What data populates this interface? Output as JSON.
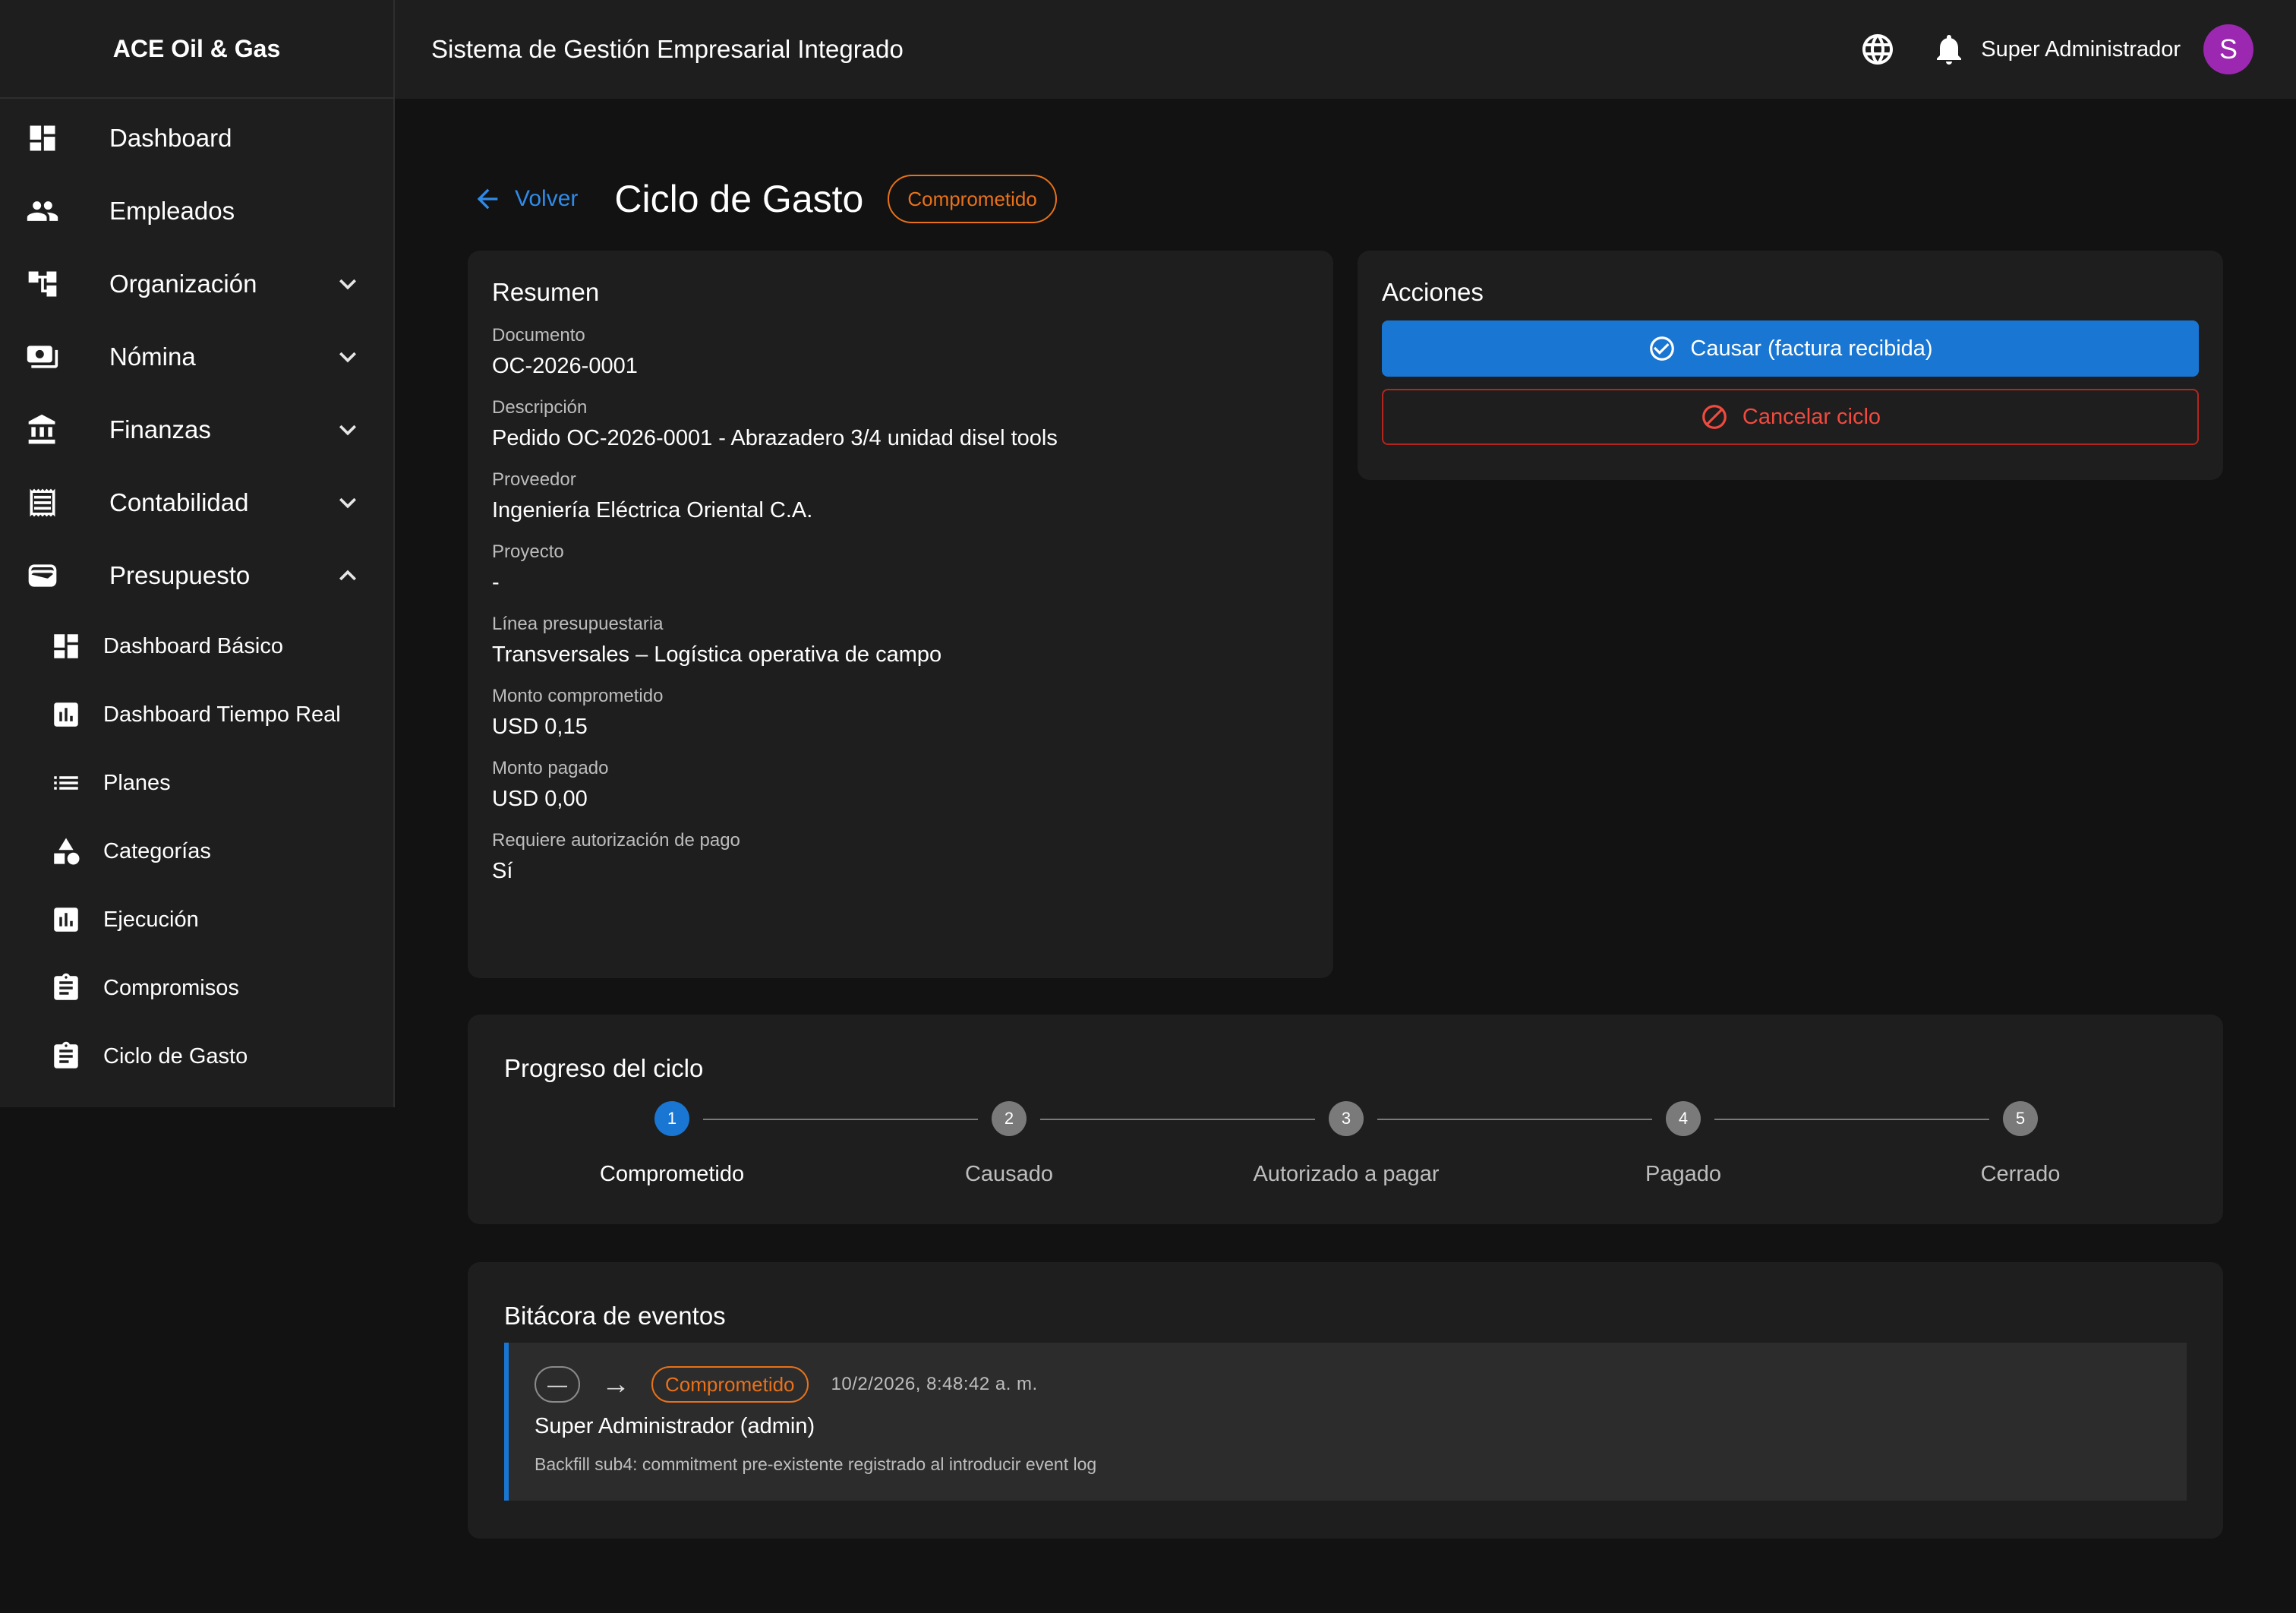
{
  "app": {
    "brand": "ACE Oil & Gas",
    "title": "Sistema de Gestión Empresarial Integrado"
  },
  "topbar": {
    "user_name": "Super Administrador",
    "avatar_initial": "S"
  },
  "sidebar": {
    "items": [
      {
        "label": "Dashboard",
        "icon": "dashboard-icon"
      },
      {
        "label": "Empleados",
        "icon": "people-icon"
      },
      {
        "label": "Organización",
        "icon": "org-tree-icon",
        "expand": "collapsed"
      },
      {
        "label": "Nómina",
        "icon": "payroll-icon",
        "expand": "collapsed"
      },
      {
        "label": "Finanzas",
        "icon": "bank-icon",
        "expand": "collapsed"
      },
      {
        "label": "Contabilidad",
        "icon": "receipt-icon",
        "expand": "collapsed"
      },
      {
        "label": "Presupuesto",
        "icon": "wallet-icon",
        "expand": "expanded"
      }
    ],
    "sub_items": [
      {
        "label": "Dashboard Básico",
        "icon": "dashboard-icon"
      },
      {
        "label": "Dashboard Tiempo Real",
        "icon": "bar-chart-icon"
      },
      {
        "label": "Planes",
        "icon": "list-icon"
      },
      {
        "label": "Categorías",
        "icon": "category-icon"
      },
      {
        "label": "Ejecución",
        "icon": "bar-chart-icon"
      },
      {
        "label": "Compromisos",
        "icon": "clipboard-icon"
      },
      {
        "label": "Ciclo de Gasto",
        "icon": "clipboard-icon"
      }
    ]
  },
  "page": {
    "back_label": "Volver",
    "title": "Ciclo de Gasto",
    "status": "Comprometido"
  },
  "summary": {
    "title": "Resumen",
    "fields": [
      {
        "label": "Documento",
        "value": "OC-2026-0001"
      },
      {
        "label": "Descripción",
        "value": "Pedido OC-2026-0001 - Abrazadero 3/4 unidad disel tools"
      },
      {
        "label": "Proveedor",
        "value": "Ingeniería Eléctrica Oriental C.A."
      },
      {
        "label": "Proyecto",
        "value": "-"
      },
      {
        "label": "Línea presupuestaria",
        "value": "Transversales – Logística operativa de campo"
      },
      {
        "label": "Monto comprometido",
        "value": "USD 0,15"
      },
      {
        "label": "Monto pagado",
        "value": "USD 0,00"
      },
      {
        "label": "Requiere autorización de pago",
        "value": "Sí"
      }
    ]
  },
  "actions": {
    "title": "Acciones",
    "primary_label": "Causar (factura recibida)",
    "cancel_label": "Cancelar ciclo"
  },
  "progress": {
    "title": "Progreso del ciclo",
    "active_step": 1,
    "steps": [
      {
        "number": "1",
        "label": "Comprometido"
      },
      {
        "number": "2",
        "label": "Causado"
      },
      {
        "number": "3",
        "label": "Autorizado a pagar"
      },
      {
        "number": "4",
        "label": "Pagado"
      },
      {
        "number": "5",
        "label": "Cerrado"
      }
    ]
  },
  "log": {
    "title": "Bitácora de eventos",
    "entries": [
      {
        "from": "—",
        "arrow": "→",
        "to": "Comprometido",
        "date": "10/2/2026, 8:48:42 a. m.",
        "user": "Super Administrador (admin)",
        "note": "Backfill sub4: commitment pre-existente registrado al introducir event log"
      }
    ]
  },
  "colors": {
    "background": "#121212",
    "surface": "#1e1e1e",
    "primary": "#1976d2",
    "link": "#2f8bea",
    "warning": "#e8711a",
    "danger": "#f04a3f",
    "avatar": "#9c27b0"
  }
}
